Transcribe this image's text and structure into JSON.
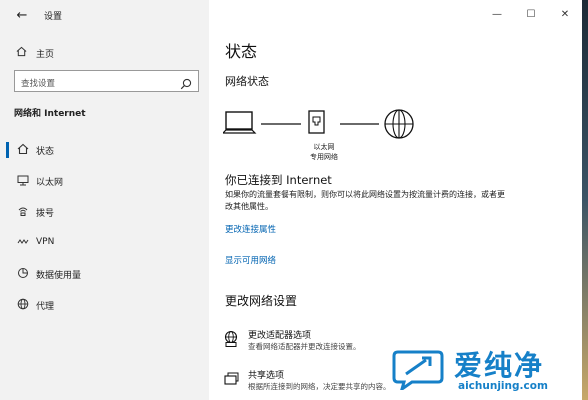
{
  "app": {
    "title": "设置",
    "window_controls": [
      "—",
      "☐",
      "✕"
    ]
  },
  "sidebar": {
    "home_label": "主页",
    "search_placeholder": "查找设置",
    "section_title": "网络和 Internet",
    "items": [
      {
        "label": "状态",
        "icon": "home-status-icon",
        "selected": true
      },
      {
        "label": "以太网",
        "icon": "ethernet-icon",
        "selected": false
      },
      {
        "label": "拨号",
        "icon": "dialup-icon",
        "selected": false
      },
      {
        "label": "VPN",
        "icon": "vpn-icon",
        "selected": false
      },
      {
        "label": "数据使用量",
        "icon": "data-usage-icon",
        "selected": false
      },
      {
        "label": "代理",
        "icon": "globe-icon",
        "selected": false
      }
    ]
  },
  "main": {
    "title": "状态",
    "network_status_heading": "网络状态",
    "diagram": {
      "label_line1": "以太网",
      "label_line2": "专用网络"
    },
    "connected_heading": "你已连接到 Internet",
    "description": "如果你的流量套餐有限制，则你可以将此网络设置为按流量计费的连接，或者更改其他属性。",
    "link_change_properties": "更改连接属性",
    "link_show_networks": "显示可用网络",
    "change_settings_heading": "更改网络设置",
    "options": [
      {
        "title": "更改适配器选项",
        "desc": "查看网络适配器并更改连接设置。",
        "icon": "adapter-icon"
      },
      {
        "title": "共享选项",
        "desc": "根据所连接到的网络，决定要共享的内容。",
        "icon": "sharing-icon"
      }
    ]
  },
  "watermark": {
    "brand": "爱纯净",
    "url": "aichunjing.com"
  },
  "colors": {
    "accent": "#0063b1",
    "sidebar_bg": "#f2f2f2",
    "watermark": "#1680c8"
  }
}
